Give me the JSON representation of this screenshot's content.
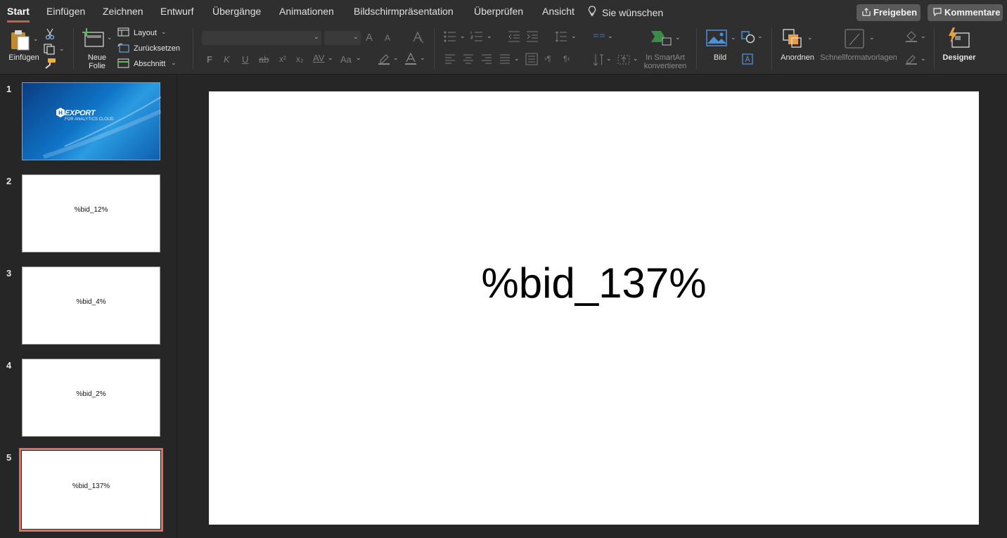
{
  "tabs": [
    "Start",
    "Einfügen",
    "Zeichnen",
    "Entwurf",
    "Übergänge",
    "Animationen",
    "Bildschirmpräsentation",
    "Überprüfen",
    "Ansicht"
  ],
  "tell_me": "Sie wünschen",
  "share_button": "Freigeben",
  "comments_button": "Kommentare",
  "ribbon": {
    "paste": "Einfügen",
    "new_slide": "Neue\nFolie",
    "layout": "Layout",
    "reset": "Zurücksetzen",
    "section": "Abschnitt",
    "bold": "F",
    "italic": "K",
    "underline": "U",
    "strike": "ab",
    "superscript": "x²",
    "subscript": "x₂",
    "spacing": "AV",
    "case": "Aa",
    "grow_font": "A",
    "shrink_font": "A",
    "smartart": "In SmartArt\nkonvertieren",
    "picture": "Bild",
    "arrange": "Anordnen",
    "quick_styles": "Schnellformatvorlagen",
    "designer": "Designer"
  },
  "slides": [
    {
      "number": "1",
      "text": "",
      "logo_text": "EXPORT",
      "logo_sub": "FOR ANALYTICS CLOUD"
    },
    {
      "number": "2",
      "text": "%bid_12%"
    },
    {
      "number": "3",
      "text": "%bid_4%"
    },
    {
      "number": "4",
      "text": "%bid_2%"
    },
    {
      "number": "5",
      "text": "%bid_137%"
    }
  ],
  "current_slide": {
    "text": "%bid_137%"
  },
  "colors": {
    "accent": "#d35c45",
    "selection": "#e0705a",
    "background": "#262626"
  }
}
